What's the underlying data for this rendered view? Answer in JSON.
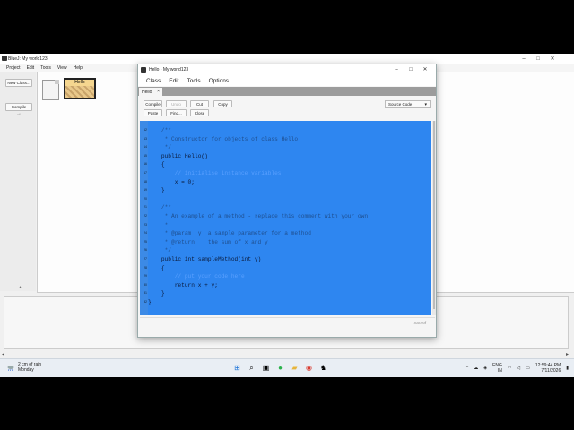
{
  "bluej": {
    "title": "BlueJ: My world123",
    "menu": [
      "Project",
      "Edit",
      "Tools",
      "View",
      "Help"
    ],
    "new_class_label": "New Class...",
    "arrow_label": "→",
    "compile_label": "Compile",
    "class_name": "Hello"
  },
  "editor": {
    "title": "Hello - My world123",
    "menu": [
      "Class",
      "Edit",
      "Tools",
      "Options"
    ],
    "tab_label": "Hello",
    "tab_close": "×",
    "toolbar": {
      "compile": "Compile",
      "undo": "Undo",
      "cut": "Cut",
      "copy": "Copy",
      "paste": "Paste",
      "find": "Find...",
      "close": "Close"
    },
    "view_select": "Source Code",
    "status": "saved",
    "lines": [
      {
        "n": "12",
        "t": "    /**",
        "cls": "cm"
      },
      {
        "n": "13",
        "t": "     * Constructor for objects of class Hello",
        "cls": "cm"
      },
      {
        "n": "14",
        "t": "     */",
        "cls": "cm"
      },
      {
        "n": "15",
        "t": "    public Hello()",
        "cls": ""
      },
      {
        "n": "16",
        "t": "    {",
        "cls": ""
      },
      {
        "n": "17",
        "t": "        // initialise instance variables",
        "cls": "ghost"
      },
      {
        "n": "18",
        "t": "        x = 0;",
        "cls": ""
      },
      {
        "n": "19",
        "t": "    }",
        "cls": ""
      },
      {
        "n": "20",
        "t": "",
        "cls": ""
      },
      {
        "n": "21",
        "t": "    /**",
        "cls": "cm"
      },
      {
        "n": "22",
        "t": "     * An example of a method - replace this comment with your own",
        "cls": "cm"
      },
      {
        "n": "23",
        "t": "     *",
        "cls": "cm"
      },
      {
        "n": "24",
        "t": "     * @param  y  a sample parameter for a method",
        "cls": "cm"
      },
      {
        "n": "25",
        "t": "     * @return    the sum of x and y",
        "cls": "cm"
      },
      {
        "n": "26",
        "t": "     */",
        "cls": "cm"
      },
      {
        "n": "27",
        "t": "    public int sampleMethod(int y)",
        "cls": ""
      },
      {
        "n": "28",
        "t": "    {",
        "cls": ""
      },
      {
        "n": "29",
        "t": "        // put your code here",
        "cls": "ghost"
      },
      {
        "n": "30",
        "t": "        return x + y;",
        "cls": ""
      },
      {
        "n": "31",
        "t": "    }",
        "cls": ""
      },
      {
        "n": "32",
        "t": "}",
        "cls": ""
      }
    ]
  },
  "taskbar": {
    "weather_temp": "2 cm of rain",
    "weather_day": "Monday",
    "lang1": "ENG",
    "lang2": "IN",
    "time": "12:59:44 PM",
    "date": "7/11/2026"
  },
  "colors": {
    "selection": "#2e86f0",
    "class_header": "#f5d68f"
  }
}
